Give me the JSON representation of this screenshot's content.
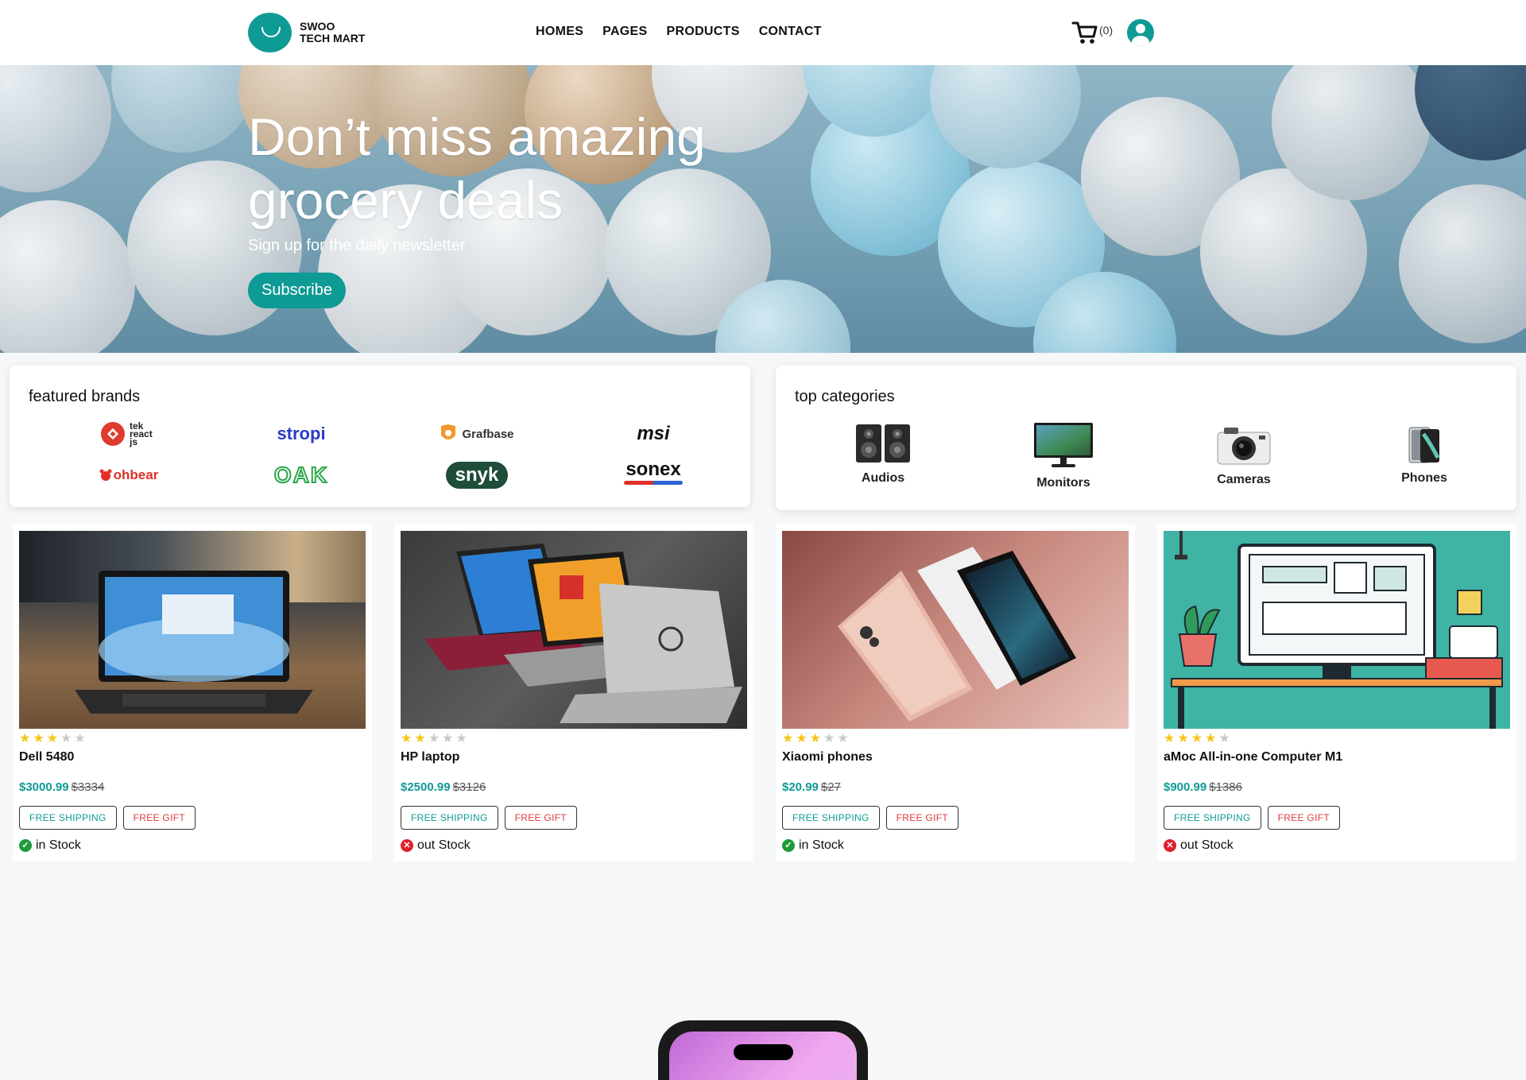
{
  "header": {
    "logo_line1": "SWOO",
    "logo_line2": "TECH MART",
    "nav": [
      "HOMES",
      "PAGES",
      "PRODUCTS",
      "CONTACT"
    ],
    "cart_count": "(0)",
    "accent": "#0f9b95"
  },
  "hero": {
    "title": "Don’t miss amazing grocery deals",
    "subtitle": "Sign up for the daily newsletter",
    "button": "Subscribe"
  },
  "brands": {
    "heading": "featured brands",
    "items": [
      {
        "name": "tek react js",
        "icon": "tek-react-logo"
      },
      {
        "name": "stropi",
        "icon": "stropi-logo"
      },
      {
        "name": "Grafbase",
        "icon": "grafbase-logo"
      },
      {
        "name": "msi",
        "icon": "msi-logo"
      },
      {
        "name": "ohbear",
        "icon": "ohbear-logo"
      },
      {
        "name": "OAK",
        "icon": "oak-logo"
      },
      {
        "name": "snyk",
        "icon": "snyk-logo"
      },
      {
        "name": "sonex",
        "icon": "sonex-logo"
      }
    ]
  },
  "categories": {
    "heading": "top categories",
    "items": [
      {
        "label": "Audios",
        "icon": "speaker-icon"
      },
      {
        "label": "Monitors",
        "icon": "monitor-icon"
      },
      {
        "label": "Cameras",
        "icon": "camera-icon"
      },
      {
        "label": "Phones",
        "icon": "phone-icon"
      }
    ]
  },
  "products": [
    {
      "name": "Dell 5480",
      "price": "$3000.99",
      "old_price": "$3334",
      "rating": 3,
      "shipping": "FREE SHIPPING",
      "gift": "FREE GIFT",
      "stock": "in Stock",
      "in_stock": true,
      "image": "laptop-photo"
    },
    {
      "name": "HP laptop",
      "price": "$2500.99",
      "old_price": "$3126",
      "rating": 2,
      "shipping": "FREE SHIPPING",
      "gift": "FREE GIFT",
      "stock": "out Stock",
      "in_stock": false,
      "image": "laptops-photo"
    },
    {
      "name": "Xiaomi phones",
      "price": "$20.99",
      "old_price": "$27",
      "rating": 3,
      "shipping": "FREE SHIPPING",
      "gift": "FREE GIFT",
      "stock": "in Stock",
      "in_stock": true,
      "image": "phones-photo"
    },
    {
      "name": "aMoc All-in-one Computer M1",
      "price": "$900.99",
      "old_price": "$1386",
      "rating": 4,
      "shipping": "FREE SHIPPING",
      "gift": "FREE GIFT",
      "stock": "out Stock",
      "in_stock": false,
      "image": "computer-illustration"
    }
  ]
}
